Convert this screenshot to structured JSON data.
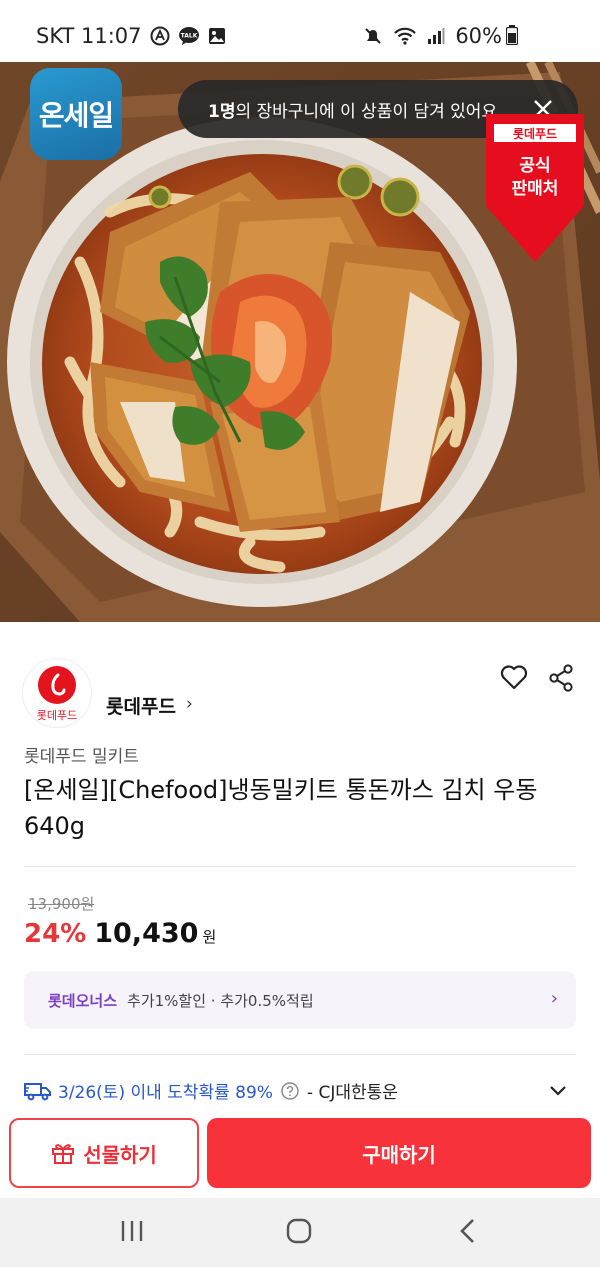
{
  "status_bar": {
    "carrier_time": "SKT 11:07",
    "battery": "60%",
    "icons": [
      "a-icon",
      "talk-icon",
      "gallery-icon",
      "mute-icon",
      "wifi-icon",
      "signal-icon",
      "battery-icon"
    ],
    "talk_text": "TALK"
  },
  "hero": {
    "onsale_logo": "온세일",
    "toast_count": "1명",
    "toast_text": "의 장바구니에 이 상품이 담겨 있어요.",
    "badge_brand": "롯데푸드",
    "badge_line1": "공식",
    "badge_line2": "판매처"
  },
  "brand": {
    "logo_text": "롯데푸드",
    "name": "롯데푸드",
    "chevron": "›"
  },
  "product": {
    "category": "롯데푸드 밀키트",
    "title": "[온세일][Chefood]냉동밀키트 통돈까스 김치 우동 640g",
    "original_price": "13,900원",
    "discount": "24%",
    "sale_price": "10,430",
    "currency": "원"
  },
  "bonus": {
    "brand": "롯데오너스",
    "text": "추가1%할인 · 추가0.5%적립",
    "chevron": "›"
  },
  "delivery": {
    "date": "3/26(토) 이내 도착확률 89%",
    "carrier": "- CJ대한통운"
  },
  "actions": {
    "gift_label": "선물하기",
    "buy_label": "구매하기"
  },
  "colors": {
    "accent_red": "#f7323a",
    "discount_red": "#e5383b",
    "bonus_purple": "#7b3fc4",
    "delivery_blue": "#2757c9"
  }
}
